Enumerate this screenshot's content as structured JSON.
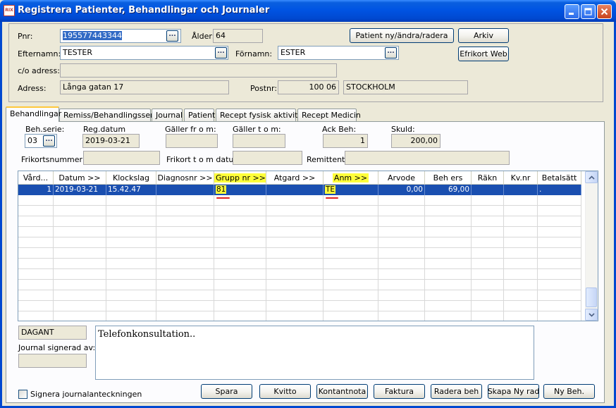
{
  "window": {
    "title": "Registrera Patienter, Behandlingar och Journaler",
    "icon_text": "RIX",
    "minimize": "_",
    "maximize": "□",
    "close": "✕"
  },
  "patient": {
    "pnr_label": "Pnr:",
    "pnr_value": "195577443344",
    "alder_label": "Ålder:",
    "alder_value": "64",
    "efternamn_label": "Efternamn:",
    "efternamn_value": "TESTER",
    "fornamn_label": "Förnamn:",
    "fornamn_value": "ESTER",
    "co_label": "c/o adress:",
    "co_value": "",
    "adress_label": "Adress:",
    "adress_value": "Långa gatan 17",
    "postnr_label": "Postnr:",
    "postnr_value": "100 06",
    "ort_value": "STOCKHOLM",
    "browse": "..."
  },
  "top_buttons": {
    "patient": "Patient ny/ändra/radera",
    "arkiv": "Arkiv",
    "efrikort": "Efrikort Web"
  },
  "tabs": [
    "Behandlingar",
    "Remiss/Behandlingsserie",
    "Journal",
    "Patient",
    "Recept fysisk aktivitet",
    "Recept Medicin"
  ],
  "behandling": {
    "behserie_label": "Beh.serie:",
    "behserie_value": "03",
    "regdatum_label": "Reg.datum",
    "regdatum_value": "2019-03-21",
    "galler_from_label": "Gäller fr o m:",
    "galler_from_value": "",
    "galler_tom_label": "Gäller t o m:",
    "galler_tom_value": "",
    "ackbeh_label": "Ack Beh:",
    "ackbeh_value": "1",
    "skuld_label": "Skuld:",
    "skuld_value": "200,00",
    "frikortsnummer_label": "Frikortsnummer:",
    "frikortsnummer_value": "",
    "frikort_tom_label": "Frikort t o m datum:",
    "frikort_tom_value": "",
    "remittent_label": "Remittent:",
    "remittent_value": ""
  },
  "grid": {
    "columns": [
      "Vård...",
      "Datum >>",
      "Klockslag",
      "Diagnosnr >>",
      "Grupp nr >>",
      "Atgard >>",
      "Anm >>",
      "Arvode",
      "Beh ers",
      "Räkn",
      "Kv.nr",
      "Betalsätt"
    ],
    "highlighted_columns": [
      "Grupp nr >>",
      "Anm >>"
    ],
    "rows": [
      [
        "1",
        "2019-03-21",
        "15.42.47",
        "",
        "81",
        "",
        "TE",
        "0,00",
        "69,00",
        "",
        "",
        "."
      ]
    ],
    "selected_row": 0,
    "highlight_color": "#FFFF3A",
    "selection_color": "#1A4FB0",
    "annotation_color": "#E02020"
  },
  "bottom": {
    "dagant_value": "DAGANT",
    "signerad_label": "Journal signerad av:",
    "signerad_value": "",
    "journal_text": "Telefonkonsultation..",
    "signera_label": "Signera journalanteckningen",
    "buttons": [
      "Spara",
      "Kvitto",
      "Kontantnota",
      "Faktura",
      "Radera beh",
      "Skapa Ny rad",
      "Ny Beh."
    ]
  }
}
